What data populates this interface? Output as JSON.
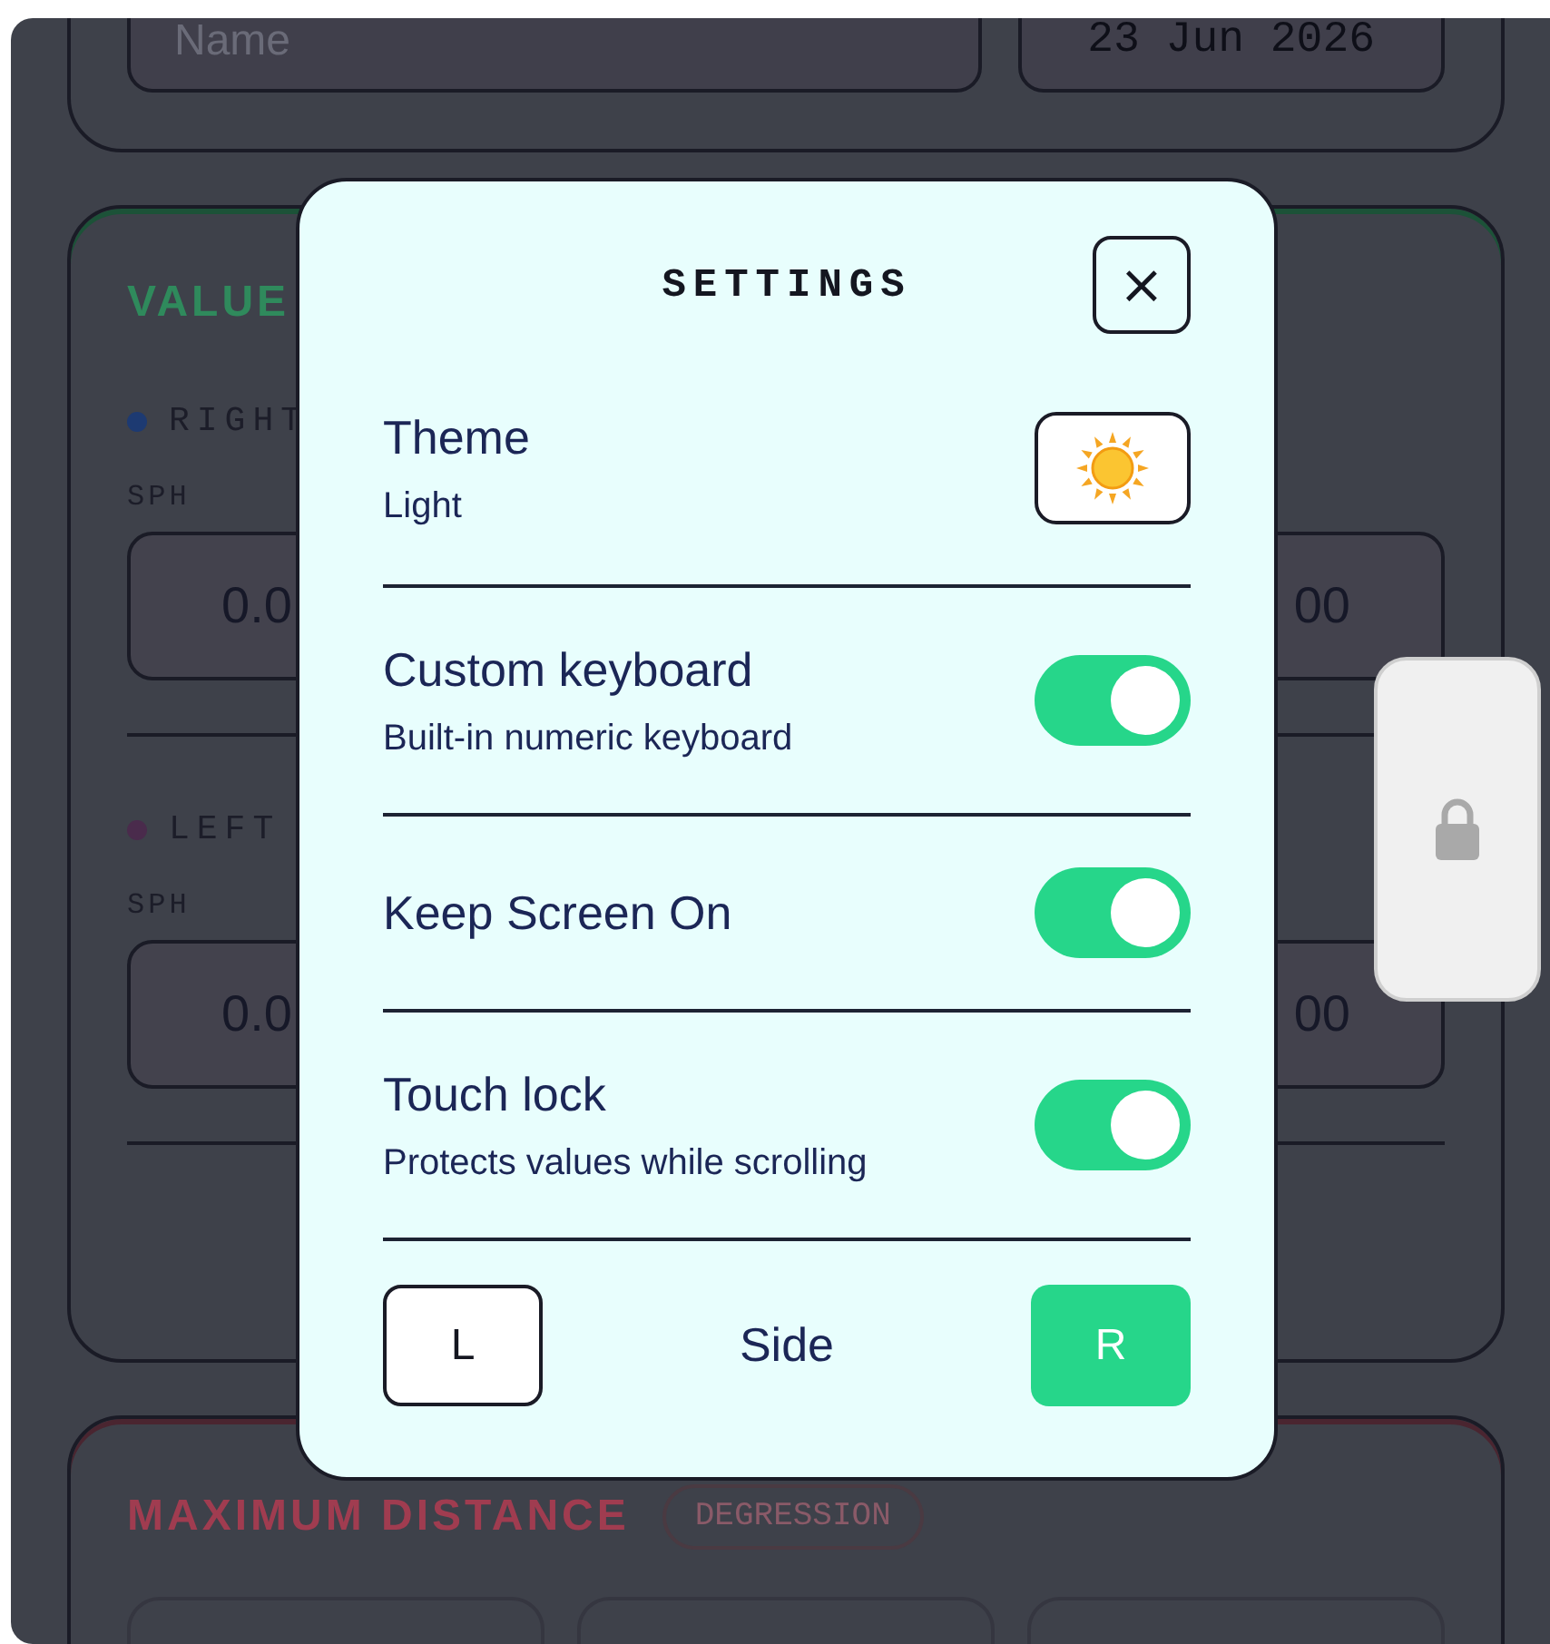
{
  "background": {
    "name_field": {
      "placeholder": "Name"
    },
    "date_field": {
      "value": "23 Jun 2026"
    },
    "values_card": {
      "title": "VALUE",
      "eyes": [
        {
          "label": "RIGHT",
          "color": "#1d3a72",
          "field_label": "SPH",
          "left_value": "0.0",
          "right_value": "00"
        },
        {
          "label": "LEFT",
          "color": "#4a2b4c",
          "field_label": "SPH",
          "left_value": "0.0",
          "right_value": "00"
        }
      ]
    },
    "distance_card": {
      "title": "MAXIMUM DISTANCE",
      "badge": "DEGRESSION"
    }
  },
  "settings": {
    "title": "SETTINGS",
    "close": "×",
    "rows": [
      {
        "kind": "theme",
        "label": "Theme",
        "sub": "Light"
      },
      {
        "kind": "toggle",
        "label": "Custom keyboard",
        "sub": "Built-in numeric keyboard",
        "on": true
      },
      {
        "kind": "toggle",
        "label": "Keep Screen On",
        "on": true
      },
      {
        "kind": "toggle",
        "label": "Touch lock",
        "sub": "Protects values while scrolling",
        "on": true
      }
    ],
    "side": {
      "label": "Side",
      "options": [
        {
          "label": "L",
          "selected": false
        },
        {
          "label": "R",
          "selected": true
        }
      ]
    }
  }
}
